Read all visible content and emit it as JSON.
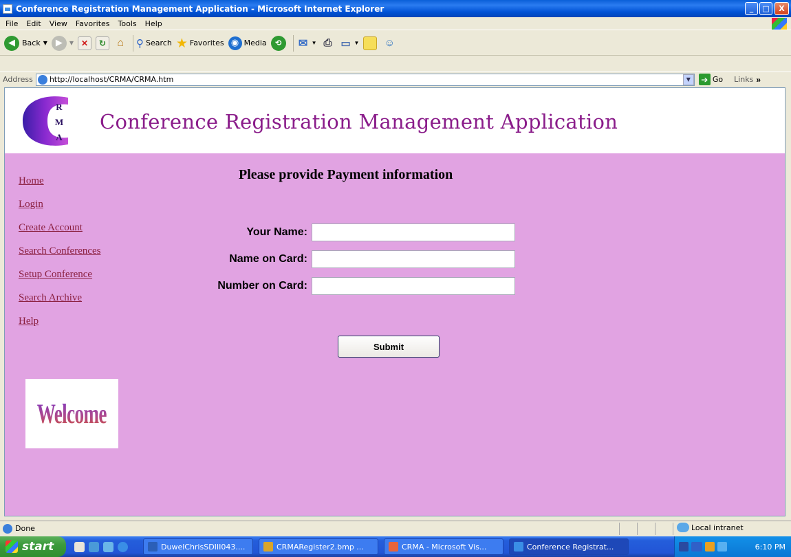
{
  "window": {
    "title": "Conference Registration Management Application - Microsoft Internet Explorer",
    "min_label": "_",
    "max_label": "□",
    "close_label": "X"
  },
  "menu": [
    "File",
    "Edit",
    "View",
    "Favorites",
    "Tools",
    "Help"
  ],
  "toolbar": {
    "back_label": "Back",
    "search_label": "Search",
    "favorites_label": "Favorites",
    "media_label": "Media"
  },
  "address": {
    "label": "Address",
    "url": "http://localhost/CRMA/CRMA.htm",
    "go_label": "Go",
    "links_label": "Links"
  },
  "page": {
    "logo_letters": [
      "R",
      "M",
      "A"
    ],
    "app_title": "Conference Registration Management Application",
    "nav": [
      "Home",
      "Login",
      "Create Account",
      "Search Conferences",
      "Setup Conference",
      "Search Archive",
      "Help"
    ],
    "welcome_text": "Welcome",
    "heading": "Please provide Payment information",
    "form": {
      "your_name_label": "Your Name:",
      "your_name_value": "",
      "name_on_card_label": "Name on Card:",
      "name_on_card_value": "",
      "number_on_card_label": "Number on Card:",
      "number_on_card_value": "",
      "submit_label": "Submit"
    }
  },
  "status": {
    "text": "Done",
    "zone": "Local intranet"
  },
  "taskbar": {
    "start_label": "start",
    "tasks": [
      {
        "label": "DuwelChrisSDIII043....",
        "color": "#2b5fb8"
      },
      {
        "label": "CRMARegister2.bmp ...",
        "color": "#d9a52a"
      },
      {
        "label": "CRMA - Microsoft Vis...",
        "color": "#e8643c"
      },
      {
        "label": "Conference Registrat...",
        "color": "#3a8ee6"
      }
    ],
    "clock": "6:10 PM"
  },
  "colors": {
    "content_bg": "#e1a3e2",
    "title_text": "#8a1c8a",
    "nav_link": "#8b2040",
    "logo_purple": "#7d2bd0"
  }
}
